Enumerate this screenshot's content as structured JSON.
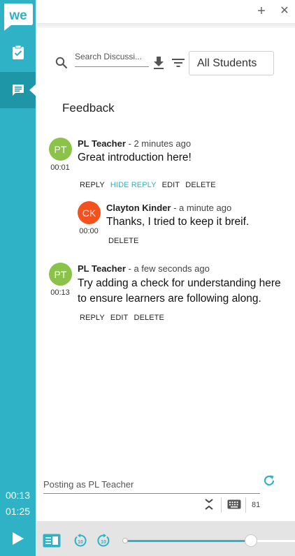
{
  "app": {
    "logo_text": "we"
  },
  "sidebar": {
    "items": [
      {
        "icon": "clipboard-check-icon",
        "active": false
      },
      {
        "icon": "comment-icon",
        "active": true
      }
    ],
    "current_time": "00:13",
    "duration": "01:25"
  },
  "topbar": {
    "add_icon": "+",
    "close_icon": "✕"
  },
  "toolbar": {
    "search_placeholder": "Search Discussi...",
    "filter_value": "All Students"
  },
  "section": {
    "title": "Feedback"
  },
  "comments": [
    {
      "initials": "PT",
      "avatar_color": "#8bc34a",
      "timestamp": "00:01",
      "author": "PL Teacher",
      "when": " - 2 minutes ago",
      "text": "Great introduction here!",
      "actions": [
        "REPLY",
        "HIDE REPLY",
        "EDIT",
        "DELETE"
      ]
    },
    {
      "initials": "CK",
      "avatar_color": "#f4511e",
      "timestamp": "00:00",
      "author": "Clayton Kinder",
      "when": " - a minute ago",
      "text": "Thanks, I tried to keep it breif.",
      "actions": [
        "DELETE"
      ]
    },
    {
      "initials": "PT",
      "avatar_color": "#8bc34a",
      "timestamp": "00:13",
      "author": "PL Teacher",
      "when": " - a few seconds ago",
      "text": "Try adding a check for understanding here to ensure learners are following along.",
      "actions": [
        "REPLY",
        "EDIT",
        "DELETE"
      ]
    }
  ],
  "composer": {
    "placeholder": "Posting as PL Teacher",
    "char_count": "81"
  },
  "player": {
    "progress": 0.74,
    "accent_color": "#2fb2c5"
  }
}
